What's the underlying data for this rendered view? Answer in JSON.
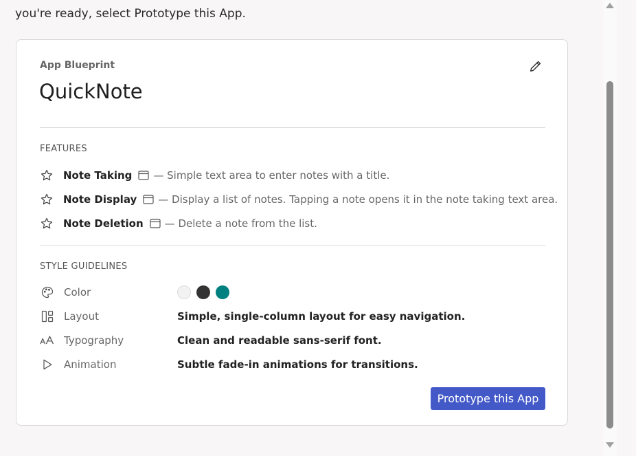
{
  "intro_text": "you're ready, select Prototype this App.",
  "card": {
    "eyebrow": "App Blueprint",
    "title": "QuickNote",
    "features_heading": "FEATURES",
    "features": [
      {
        "name": "Note Taking",
        "description": "— Simple text area to enter notes with a title."
      },
      {
        "name": "Note Display",
        "description": "— Display a list of notes. Tapping a note opens it in the note taking text area."
      },
      {
        "name": "Note Deletion",
        "description": "— Delete a note from the list."
      }
    ],
    "style_heading": "STYLE GUIDELINES",
    "style": {
      "color_label": "Color",
      "color_swatches": [
        "#f2f2f2",
        "#333333",
        "#008080"
      ],
      "layout_label": "Layout",
      "layout_value": "Simple, single-column layout for easy navigation.",
      "typography_label": "Typography",
      "typography_value": "Clean and readable sans-serif font.",
      "animation_label": "Animation",
      "animation_value": "Subtle fade-in animations for transitions."
    },
    "button_label": "Prototype this App"
  }
}
